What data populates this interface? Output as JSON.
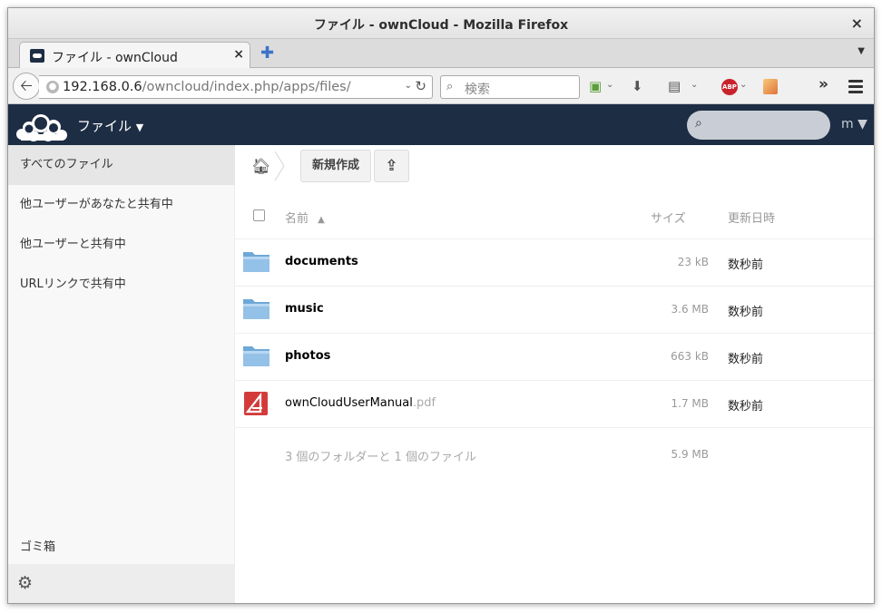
{
  "window": {
    "title": "ファイル - ownCloud - Mozilla Firefox",
    "close_glyph": "×"
  },
  "tabs": [
    {
      "label": "ファイル - ownCloud",
      "close_glyph": "×"
    }
  ],
  "new_tab_glyph": "✚",
  "nav": {
    "url_host": "192.168.0.6",
    "url_path": "/owncloud/index.php/apps/files/",
    "search_placeholder": "検索"
  },
  "toolbar_icons": [
    "back-icon",
    "globe-icon",
    "reload-icon",
    "search-icon",
    "sync-icon",
    "download-icon",
    "reader-icon",
    "adblock-icon",
    "extension-icon",
    "overflow-icon",
    "menu-icon"
  ],
  "abp_label": "ABP",
  "app": {
    "name": "ファイル",
    "name_caret": "▼",
    "user": "m ▼"
  },
  "sidebar": {
    "items": [
      {
        "label": "すべてのファイル",
        "active": true
      },
      {
        "label": "他ユーザーがあなたと共有中",
        "active": false
      },
      {
        "label": "他ユーザーと共有中",
        "active": false
      },
      {
        "label": "URLリンクで共有中",
        "active": false
      }
    ],
    "trash": "ゴミ箱"
  },
  "controls": {
    "new_label": "新規作成"
  },
  "table": {
    "headers": {
      "name": "名前",
      "sort_glyph": "▲",
      "size": "サイズ",
      "modified": "更新日時"
    },
    "rows": [
      {
        "type": "folder",
        "name": "documents",
        "ext": "",
        "size": "23 kB",
        "modified": "数秒前"
      },
      {
        "type": "folder",
        "name": "music",
        "ext": "",
        "size": "3.6 MB",
        "modified": "数秒前"
      },
      {
        "type": "folder",
        "name": "photos",
        "ext": "",
        "size": "663 kB",
        "modified": "数秒前"
      },
      {
        "type": "pdf",
        "name": "ownCloudUserManual",
        "ext": ".pdf",
        "size": "1.7 MB",
        "modified": "数秒前"
      }
    ],
    "summary": {
      "text": "3 個のフォルダーと 1 個のファイル",
      "size": "5.9 MB"
    }
  },
  "colors": {
    "header_bg": "#1d2d44",
    "folder_blue": "#5b9bd5",
    "pdf_red": "#d33b3b"
  }
}
